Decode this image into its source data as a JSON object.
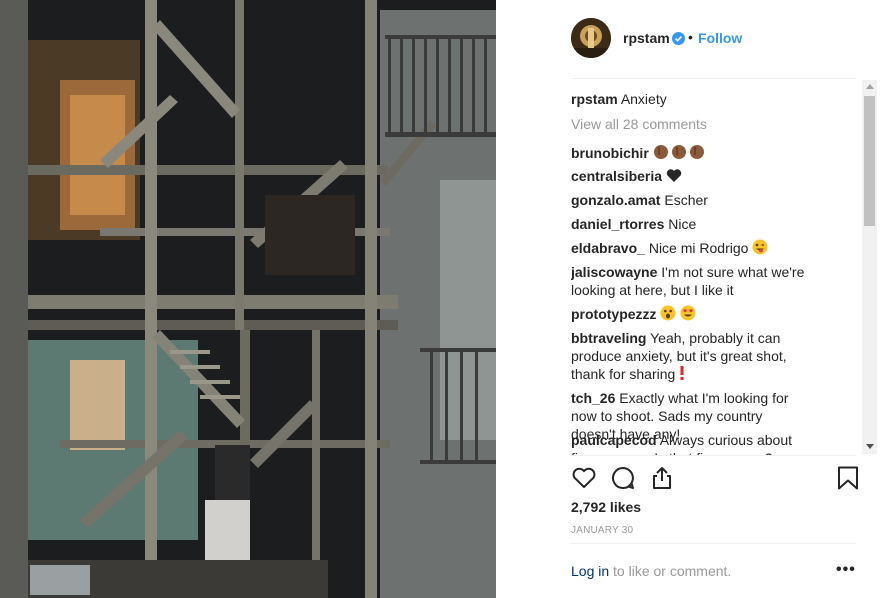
{
  "post": {
    "photo_alt": "Night view of wooden stairways and balconies",
    "author": "rpstam",
    "follow_label": "Follow",
    "separator": "•",
    "verified_icon": "verified-badge-icon"
  },
  "caption": {
    "user": "rpstam",
    "text": "Anxiety"
  },
  "view_all": "View all 28 comments",
  "comments": [
    {
      "user": "brunobichir",
      "text": ""
    },
    {
      "user": "centralsiberia",
      "text": ""
    },
    {
      "user": "gonzalo.amat",
      "text": "Escher"
    },
    {
      "user": "daniel_rtorres",
      "text": "Nice"
    },
    {
      "user": "eldabravo_",
      "text": "Nice mi Rodrigo"
    },
    {
      "user": "jaliscowayne",
      "text": "I'm not sure what we're looking at here, but I like it"
    },
    {
      "user": "prototypezzz",
      "text": ""
    },
    {
      "user": "bbtraveling",
      "text": "Yeah, probably it can produce anxiety, but it's great shot, thank for sharing"
    },
    {
      "user": "tch_26",
      "text": "Exactly what I'm looking for now to shoot. Sads my country doesn't have any!"
    },
    {
      "user": "paulcapecod",
      "text": "Always curious about fire escapes. Is that fire escape?"
    }
  ],
  "stats": {
    "likes": "2,792 likes",
    "date": "JANUARY 30"
  },
  "footer": {
    "login_label": "Log in",
    "login_suffix": " to like or comment.",
    "more_label": "•••"
  },
  "colors": {
    "accent": "#3897f0",
    "muted": "#999999",
    "text": "#262626",
    "verified": "#3897f0",
    "link": "#003569"
  }
}
